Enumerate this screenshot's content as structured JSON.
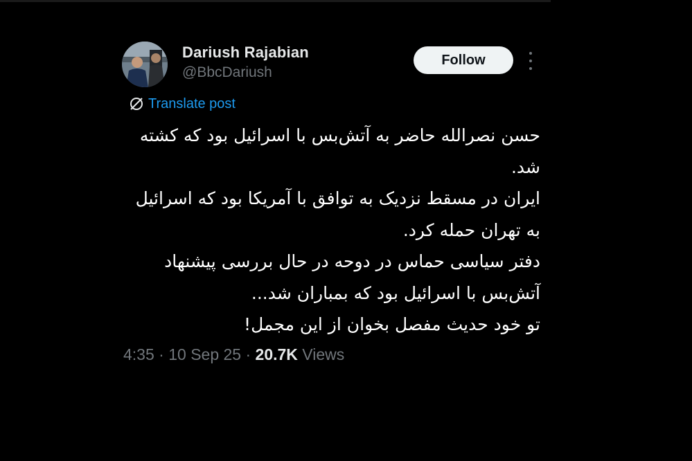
{
  "author": {
    "name": "Dariush Rajabian",
    "handle": "@BbcDariush"
  },
  "actions": {
    "follow_label": "Follow",
    "more_icon": "more-vertical-icon"
  },
  "translate": {
    "icon": "translate-globe-icon",
    "label": "Translate post"
  },
  "post": {
    "lines": [
      "حسن نصرالله حاضر به آتش‌بس با اسرائیل بود که کشته",
      "شد.",
      "ایران در مسقط نزدیک به توافق با آمریکا بود که اسرائیل",
      "به تهران حمله کرد.",
      "دفتر سیاسی حماس در دوحه در حال بررسی پیشنهاد",
      "آتش‌بس با اسرائیل بود که بمباران شد...",
      "تو خود حدیث مفصل بخوان از این مجمل!"
    ]
  },
  "meta": {
    "time": "4:35",
    "separator": " · ",
    "date": "10 Sep 25",
    "views_count": "20.7K",
    "views_label": " Views"
  },
  "colors": {
    "background": "#000000",
    "text_primary": "#e7e9ea",
    "text_secondary": "#71767b",
    "link": "#1d9bf0",
    "button_bg": "#eff3f4"
  }
}
